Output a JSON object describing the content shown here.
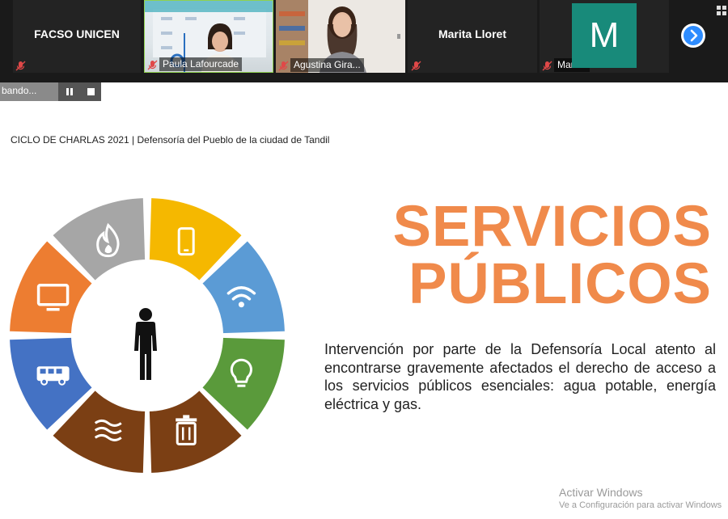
{
  "meeting": {
    "participants": [
      {
        "name": "FACSO UNICEN",
        "muted": true
      },
      {
        "name": "Paula Lafourcade",
        "muted": true
      },
      {
        "name": "Agustina Gira...",
        "muted": true
      },
      {
        "name": "Marita Lloret",
        "muted": true
      },
      {
        "name": "Marisa",
        "avatar_letter": "M",
        "avatar_color": "#188a7a",
        "muted": true
      }
    ],
    "recording_label": "bando...",
    "recording_controls": {
      "pause_icon": "pause-icon",
      "stop_icon": "stop-icon"
    },
    "next_page_icon": "chevron-right-icon",
    "accent_color": "#2d8cff"
  },
  "slide": {
    "header": "CICLO DE CHARLAS 2021 | Defensoría del Pueblo de la ciudad de Tandil",
    "title_line1": "SERVICIOS",
    "title_line2": "PÚBLICOS",
    "title_color": "#f08a4b",
    "body": "Intervención por parte de la Defensoría Local atento al encontrarse gravemente afectados el derecho de acceso a los servicios públicos esenciales: agua potable, energía eléctrica y gas.",
    "wheel_segments": [
      {
        "icon": "mobile-phone-icon",
        "color": "#f5b800"
      },
      {
        "icon": "wifi-icon",
        "color": "#5b9bd5"
      },
      {
        "icon": "lightbulb-icon",
        "color": "#5a9a3b"
      },
      {
        "icon": "trash-icon",
        "color": "#7b3f14"
      },
      {
        "icon": "water-icon",
        "color": "#7b3f14"
      },
      {
        "icon": "bus-icon",
        "color": "#4472c4"
      },
      {
        "icon": "television-icon",
        "color": "#ed7d31"
      },
      {
        "icon": "flame-icon",
        "color": "#a6a6a6"
      }
    ],
    "center_icon": "person-icon"
  },
  "watermark": {
    "line1": "Activar Windows",
    "line2": "Ve a Configuración para activar Windows"
  }
}
